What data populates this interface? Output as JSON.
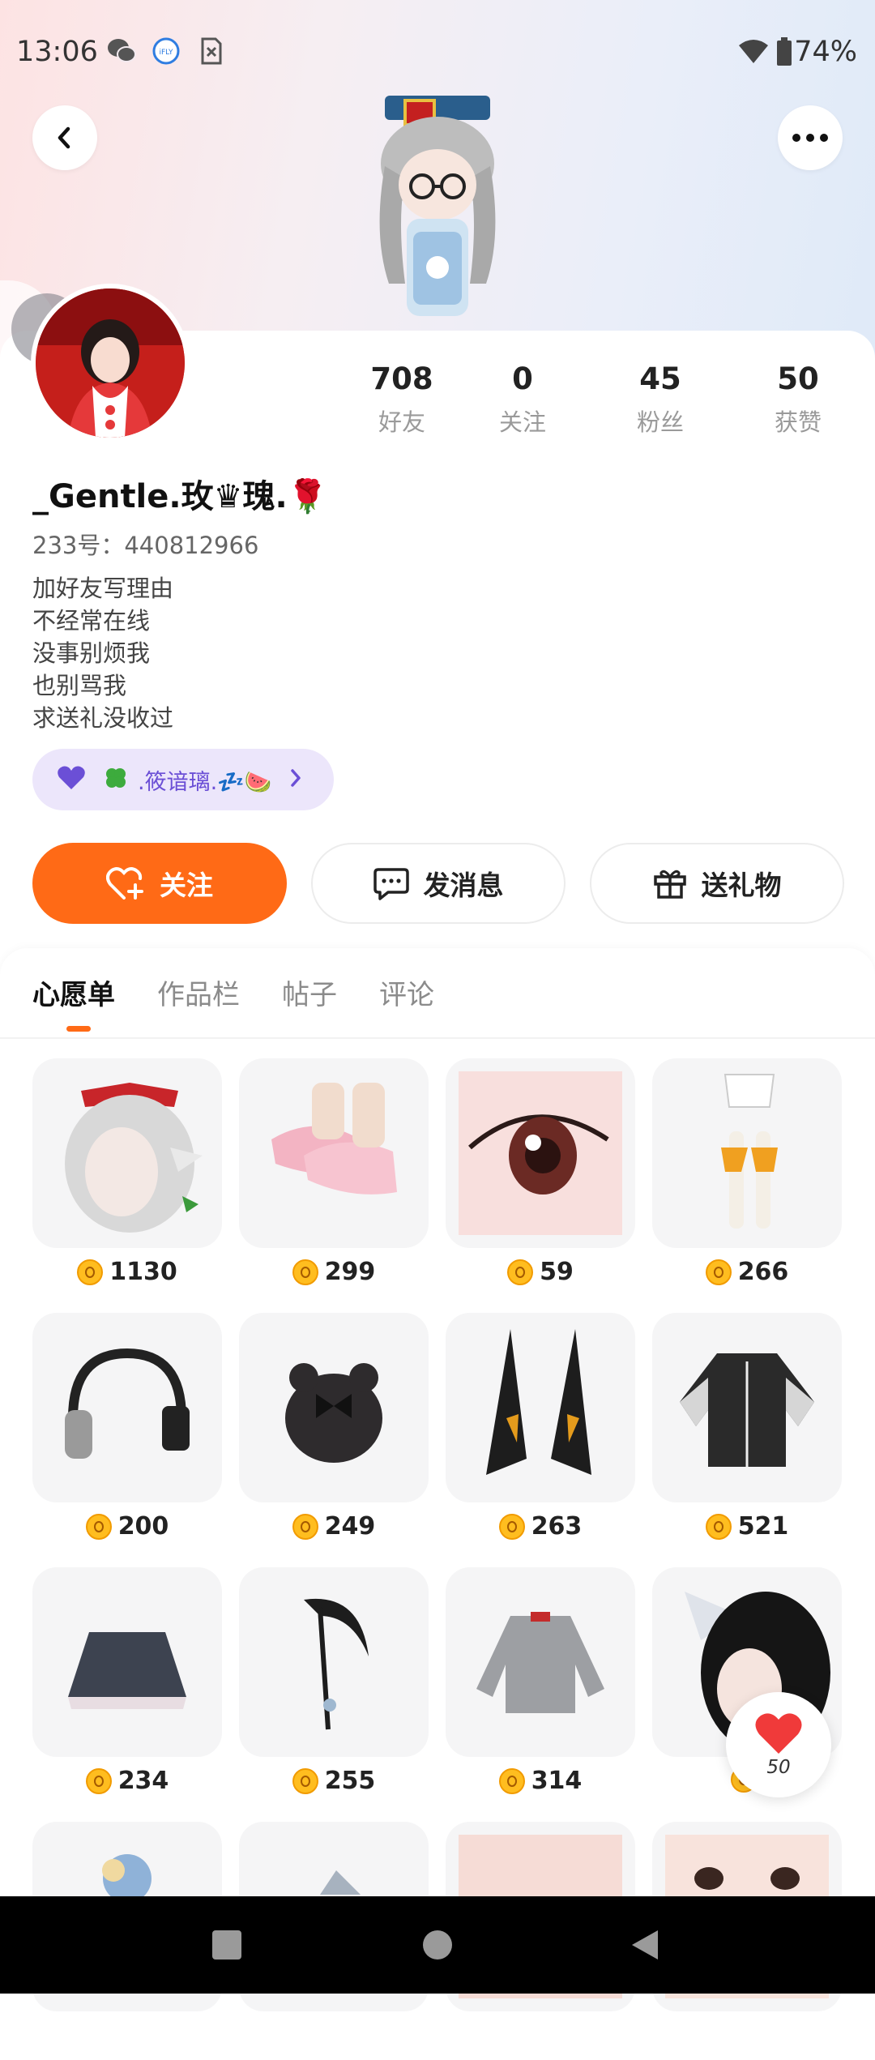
{
  "status_bar": {
    "time": "13:06",
    "battery": "74%"
  },
  "profile": {
    "name": "_Gentle.玫♛瑰.🌹",
    "uid": "233号：440812966",
    "bio": [
      "加好友写理由",
      "不经常在线",
      "没事别烦我",
      "也别骂我",
      "求送礼没收过"
    ],
    "fan_club": ".筱谙璃.💤🍉",
    "stats": [
      {
        "value": "708",
        "label": "好友"
      },
      {
        "value": "0",
        "label": "关注"
      },
      {
        "value": "45",
        "label": "粉丝"
      },
      {
        "value": "50",
        "label": "获赞"
      }
    ]
  },
  "actions": {
    "follow": "关注",
    "message": "发消息",
    "gift": "送礼物"
  },
  "tabs": [
    "心愿单",
    "作品栏",
    "帖子",
    "评论"
  ],
  "wishlist": [
    {
      "icon": "hair-with-red-bow-icon",
      "price": "1130"
    },
    {
      "icon": "pink-shoes-icon",
      "price": "299"
    },
    {
      "icon": "anime-eye-icon",
      "price": "59"
    },
    {
      "icon": "stockings-outfit-icon",
      "price": "266"
    },
    {
      "icon": "headphones-icon",
      "price": "200"
    },
    {
      "icon": "bear-backpack-icon",
      "price": "249"
    },
    {
      "icon": "black-horns-icon",
      "price": "263"
    },
    {
      "icon": "varsity-jacket-icon",
      "price": "521"
    },
    {
      "icon": "dark-skirt-icon",
      "price": "234"
    },
    {
      "icon": "scythe-icon",
      "price": "255"
    },
    {
      "icon": "grey-sweater-icon",
      "price": "314"
    },
    {
      "icon": "black-hair-bow-icon",
      "price": ""
    },
    {
      "icon": "blue-flower-icon",
      "price": ""
    },
    {
      "icon": "hat-icon",
      "price": ""
    },
    {
      "icon": "skin-patch-icon",
      "price": ""
    },
    {
      "icon": "face-eyes-icon",
      "price": ""
    }
  ],
  "like_count": "50",
  "colors": {
    "accent": "#ff6a16",
    "fan_purple": "#6b4fd6"
  }
}
